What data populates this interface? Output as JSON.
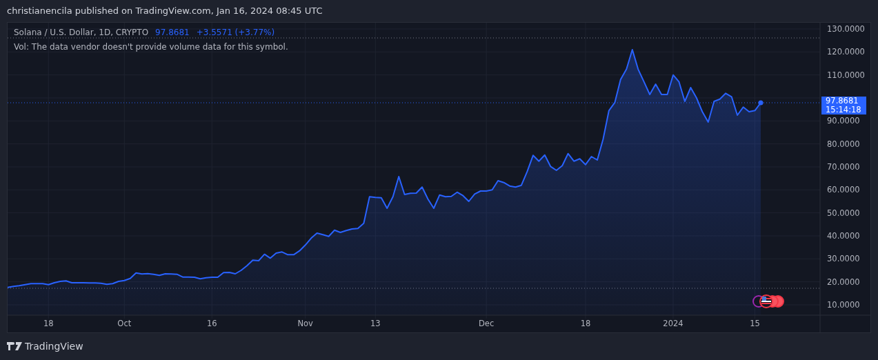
{
  "header": {
    "text": "christianencila published on TradingView.com, Jan 16, 2024 08:45 UTC"
  },
  "legend": {
    "symbol": "Solana / U.S. Dollar, 1D, CRYPTO",
    "price": "97.8681",
    "change": "+3.5571 (+3.77%)",
    "volume_note": "Vol: The data vendor doesn't provide volume data for this symbol."
  },
  "price_tag": {
    "price": "97.8681",
    "countdown": "15:14:18"
  },
  "chart": {
    "chart_data": {
      "type": "area",
      "series": [
        {
          "color": "#2962ff",
          "values": [
            17.6,
            18.0,
            18.3,
            18.8,
            19.2,
            19.2,
            19.2,
            18.8,
            19.6,
            20.2,
            20.4,
            19.6,
            19.6,
            19.6,
            19.5,
            19.5,
            19.4,
            18.9,
            19.2,
            20.2,
            20.6,
            21.5,
            23.9,
            23.4,
            23.6,
            23.3,
            22.8,
            23.5,
            23.4,
            23.3,
            22.1,
            22.1,
            22.0,
            21.3,
            21.8,
            22.0,
            22.0,
            24.0,
            24.1,
            23.5,
            25.0,
            27.0,
            29.4,
            29.2,
            32.0,
            30.3,
            32.5,
            33.0,
            31.8,
            31.8,
            33.5,
            36.0,
            39.0,
            41.2,
            40.5,
            39.8,
            42.5,
            41.5,
            42.3,
            43.0,
            43.2,
            45.5,
            57.0,
            56.7,
            56.6,
            52.0,
            57.0,
            65.8,
            58.0,
            58.5,
            58.6,
            61.2,
            56.0,
            52.0,
            57.8,
            57.0,
            57.2,
            59.0,
            57.5,
            55.0,
            58.2,
            59.5,
            59.5,
            60.0,
            64.0,
            63.2,
            61.7,
            61.2,
            62.0,
            68.0,
            75.0,
            72.5,
            75.2,
            70.2,
            68.5,
            70.5,
            75.8,
            72.5,
            73.5,
            71.0,
            74.5,
            73.0,
            82.0,
            94.5,
            98.0,
            108.0,
            112.5,
            121.0,
            112.5,
            107.0,
            101.5,
            106.0,
            101.5,
            101.5,
            110.0,
            107.0,
            98.5,
            104.5,
            100.0,
            94.0,
            89.5,
            98.5,
            99.5,
            102.0,
            100.5,
            92.5,
            96.0,
            94.0,
            94.5,
            97.9
          ]
        }
      ],
      "categories": [
        null,
        null,
        null,
        null,
        null,
        null,
        null,
        "18",
        null,
        null,
        null,
        null,
        null,
        null,
        null,
        null,
        null,
        null,
        null,
        null,
        "Oct",
        null,
        null,
        null,
        null,
        null,
        null,
        null,
        null,
        null,
        null,
        null,
        null,
        null,
        null,
        "16",
        null,
        null,
        null,
        null,
        null,
        null,
        null,
        null,
        null,
        null,
        null,
        null,
        null,
        null,
        null,
        "Nov",
        null,
        null,
        null,
        null,
        null,
        null,
        null,
        null,
        null,
        null,
        null,
        "13",
        null,
        null,
        null,
        null,
        null,
        null,
        null,
        null,
        null,
        null,
        null,
        null,
        null,
        null,
        null,
        null,
        null,
        null,
        "Dec",
        null,
        null,
        null,
        null,
        null,
        null,
        null,
        null,
        null,
        null,
        null,
        null,
        null,
        null,
        null,
        null,
        "18",
        null,
        null,
        null,
        null,
        null,
        null,
        null,
        null,
        null,
        null,
        null,
        null,
        null,
        null,
        "2024",
        null,
        null,
        null,
        null,
        null,
        null,
        null,
        null,
        null,
        null,
        null,
        null,
        null,
        "15",
        null
      ],
      "ylim": [
        5.5,
        132.7
      ],
      "grid": true,
      "ref_lines": [
        {
          "axis": "y",
          "value": 126.1,
          "color": "#787b86"
        },
        {
          "axis": "y",
          "value": 17.2,
          "color": "#787b86"
        },
        {
          "axis": "y",
          "value": 97.9,
          "color": "#2962ff"
        }
      ],
      "yticks": [
        {
          "value": 10,
          "label": "10.0000"
        },
        {
          "value": 20,
          "label": "20.0000"
        },
        {
          "value": 30,
          "label": "30.0000"
        },
        {
          "value": 40,
          "label": "40.0000"
        },
        {
          "value": 50,
          "label": "50.0000"
        },
        {
          "value": 60,
          "label": "60.0000"
        },
        {
          "value": 70,
          "label": "70.0000"
        },
        {
          "value": 80,
          "label": "80.0000"
        },
        {
          "value": 90,
          "label": "90.0000"
        },
        {
          "value": 110,
          "label": "110.0000"
        },
        {
          "value": 120,
          "label": "120.0000"
        },
        {
          "value": 130,
          "label": "130.0000"
        }
      ]
    }
  },
  "footer": {
    "brand": "TradingView"
  }
}
